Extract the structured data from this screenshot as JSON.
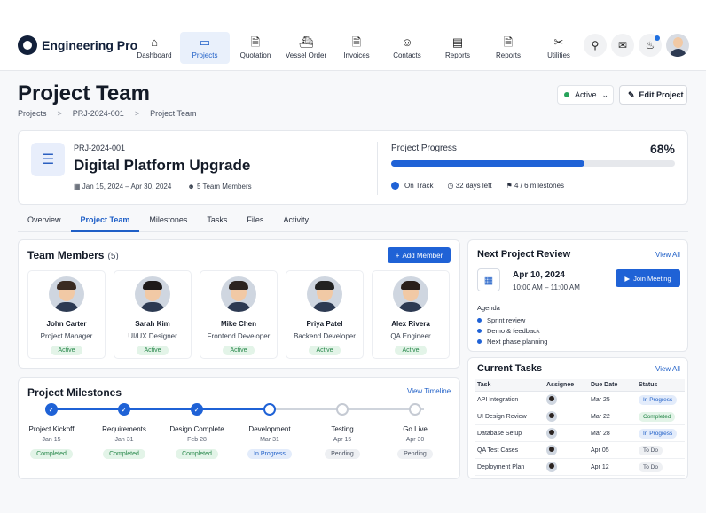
{
  "app": {
    "name": "Engineering Pro"
  },
  "nav": [
    {
      "label": "Dashboard",
      "icon": "home-icon",
      "glyph": "⌂"
    },
    {
      "label": "Projects",
      "icon": "folder-icon",
      "glyph": "▭"
    },
    {
      "label": "Quotation",
      "icon": "document-icon",
      "glyph": "🗎"
    },
    {
      "label": "Vessel Order",
      "icon": "ship-icon",
      "glyph": "⛴"
    },
    {
      "label": "Invoices",
      "icon": "invoice-icon",
      "glyph": "🗎"
    },
    {
      "label": "Contacts",
      "icon": "contact-icon",
      "glyph": "☺"
    },
    {
      "label": "Reports",
      "icon": "chart-icon",
      "glyph": "▤"
    },
    {
      "label": "Reports",
      "icon": "report-icon",
      "glyph": "🗎"
    },
    {
      "label": "Utilities",
      "icon": "tools-icon",
      "glyph": "✂"
    }
  ],
  "page": {
    "title": "Project Team",
    "crumbs": [
      "Projects",
      "PRJ-2024-001",
      "Project Team"
    ],
    "crumb_sep": ">"
  },
  "status": {
    "label": "Active",
    "chevron": "⌄"
  },
  "edit": {
    "label": "Edit Project",
    "glyph": "✎"
  },
  "project": {
    "id": "PRJ-2024-001",
    "name": "Digital Platform Upgrade",
    "dates": "Jan 15, 2024 – Apr 30, 2024",
    "members": "5 Team Members",
    "progress_label": "Project Progress",
    "progress_pct": "68%",
    "progress_value": 0.68,
    "on_track": "On Track",
    "days_left": "32 days left",
    "milestones": "4 / 6 milestones"
  },
  "tabs": [
    "Overview",
    "Project Team",
    "Milestones",
    "Tasks",
    "Files",
    "Activity"
  ],
  "team": {
    "title": "Team Members",
    "count": "(5)",
    "add_label": "Add Member",
    "members": [
      {
        "name": "John Carter",
        "role": "Project Manager",
        "status": "Active"
      },
      {
        "name": "Sarah Kim",
        "role": "UI/UX Designer",
        "status": "Active"
      },
      {
        "name": "Mike Chen",
        "role": "Frontend Developer",
        "status": "Active"
      },
      {
        "name": "Priya Patel",
        "role": "Backend Developer",
        "status": "Active"
      },
      {
        "name": "Alex Rivera",
        "role": "QA Engineer",
        "status": "Active"
      }
    ]
  },
  "milestones": {
    "title": "Project Milestones",
    "link": "View Timeline",
    "items": [
      {
        "title": "Project Kickoff",
        "date": "Jan 15",
        "status": "Completed",
        "state": "done"
      },
      {
        "title": "Requirements",
        "date": "Jan 31",
        "status": "Completed",
        "state": "done"
      },
      {
        "title": "Design Complete",
        "date": "Feb 28",
        "status": "Completed",
        "state": "done"
      },
      {
        "title": "Development",
        "date": "Mar 31",
        "status": "In Progress",
        "state": "cur"
      },
      {
        "title": "Testing",
        "date": "Apr 15",
        "status": "Pending",
        "state": "pend"
      },
      {
        "title": "Go Live",
        "date": "Apr 30",
        "status": "Pending",
        "state": "pend"
      }
    ]
  },
  "review": {
    "title": "Next Project Review",
    "link": "View All",
    "date": "Apr 10, 2024",
    "time": "10:00 AM – 11:00 AM",
    "join": "Join Meeting",
    "agenda_label": "Agenda",
    "agenda": [
      "Sprint review",
      "Demo & feedback",
      "Next phase planning"
    ]
  },
  "tasks": {
    "title": "Current Tasks",
    "link": "View All",
    "headers": [
      "Task",
      "Assignee",
      "Due Date",
      "Status"
    ],
    "rows": [
      {
        "task": "API Integration",
        "due": "Mar 25",
        "status": "In Progress",
        "kind": "b"
      },
      {
        "task": "UI Design Review",
        "due": "Mar 22",
        "status": "Completed",
        "kind": "g"
      },
      {
        "task": "Database Setup",
        "due": "Mar 28",
        "status": "In Progress",
        "kind": "b"
      },
      {
        "task": "QA Test Cases",
        "due": "Apr 05",
        "status": "To Do",
        "kind": "p"
      },
      {
        "task": "Deployment Plan",
        "due": "Apr 12",
        "status": "To Do",
        "kind": "p"
      }
    ]
  },
  "colors": {
    "accent": "#1f62d6",
    "success": "#27a35a"
  }
}
